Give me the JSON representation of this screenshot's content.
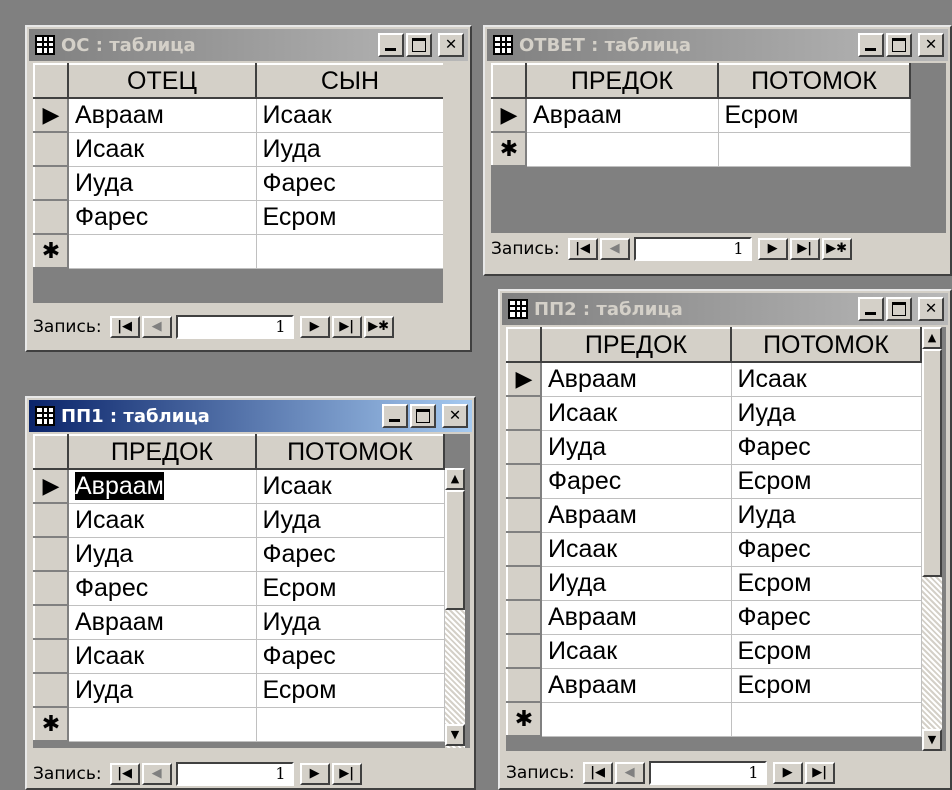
{
  "windows": {
    "oc": {
      "title": "ОС : таблица",
      "columns": [
        "ОТЕЦ",
        "СЫН"
      ],
      "rows": [
        [
          "Авраам",
          "Исаак"
        ],
        [
          "Исаак",
          "Иуда"
        ],
        [
          "Иуда",
          "Фарес"
        ],
        [
          "Фарес",
          "Есром"
        ]
      ],
      "record_label": "Запись:",
      "record_value": "1"
    },
    "otvet": {
      "title": "ОТВЕТ : таблица",
      "columns": [
        "ПРЕДОК",
        "ПОТОМОК"
      ],
      "rows": [
        [
          "Авраам",
          "Есром"
        ]
      ],
      "record_label": "Запись:",
      "record_value": "1"
    },
    "pp1": {
      "title": "ПП1 : таблица",
      "columns": [
        "ПРЕДОК",
        "ПОТОМОК"
      ],
      "rows": [
        [
          "Авраам",
          "Исаак"
        ],
        [
          "Исаак",
          "Иуда"
        ],
        [
          "Иуда",
          "Фарес"
        ],
        [
          "Фарес",
          "Есром"
        ],
        [
          "Авраам",
          "Иуда"
        ],
        [
          "Исаак",
          "Фарес"
        ],
        [
          "Иуда",
          "Есром"
        ]
      ],
      "record_label": "Запись:",
      "record_value": "1"
    },
    "pp2": {
      "title": "ПП2 : таблица",
      "columns": [
        "ПРЕДОК",
        "ПОТОМОК"
      ],
      "rows": [
        [
          "Авраам",
          "Исаак"
        ],
        [
          "Исаак",
          "Иуда"
        ],
        [
          "Иуда",
          "Фарес"
        ],
        [
          "Фарес",
          "Есром"
        ],
        [
          "Авраам",
          "Иуда"
        ],
        [
          "Исаак",
          "Фарес"
        ],
        [
          "Иуда",
          "Есром"
        ],
        [
          "Авраам",
          "Фарес"
        ],
        [
          "Исаак",
          "Есром"
        ],
        [
          "Авраам",
          "Есром"
        ]
      ],
      "record_label": "Запись:",
      "record_value": "1"
    }
  },
  "symbols": {
    "current_row": "▶",
    "new_row": "✱",
    "nav_first": "|◀",
    "nav_prev": "◀",
    "nav_next": "▶",
    "nav_last": "▶|",
    "nav_new": "▶✱",
    "scroll_up": "▲",
    "scroll_down": "▼"
  },
  "colors": {
    "desktop": "#808080",
    "active_title_start": "#0a246a",
    "inactive_title_start": "#808080",
    "window_face": "#d4d0c8"
  }
}
